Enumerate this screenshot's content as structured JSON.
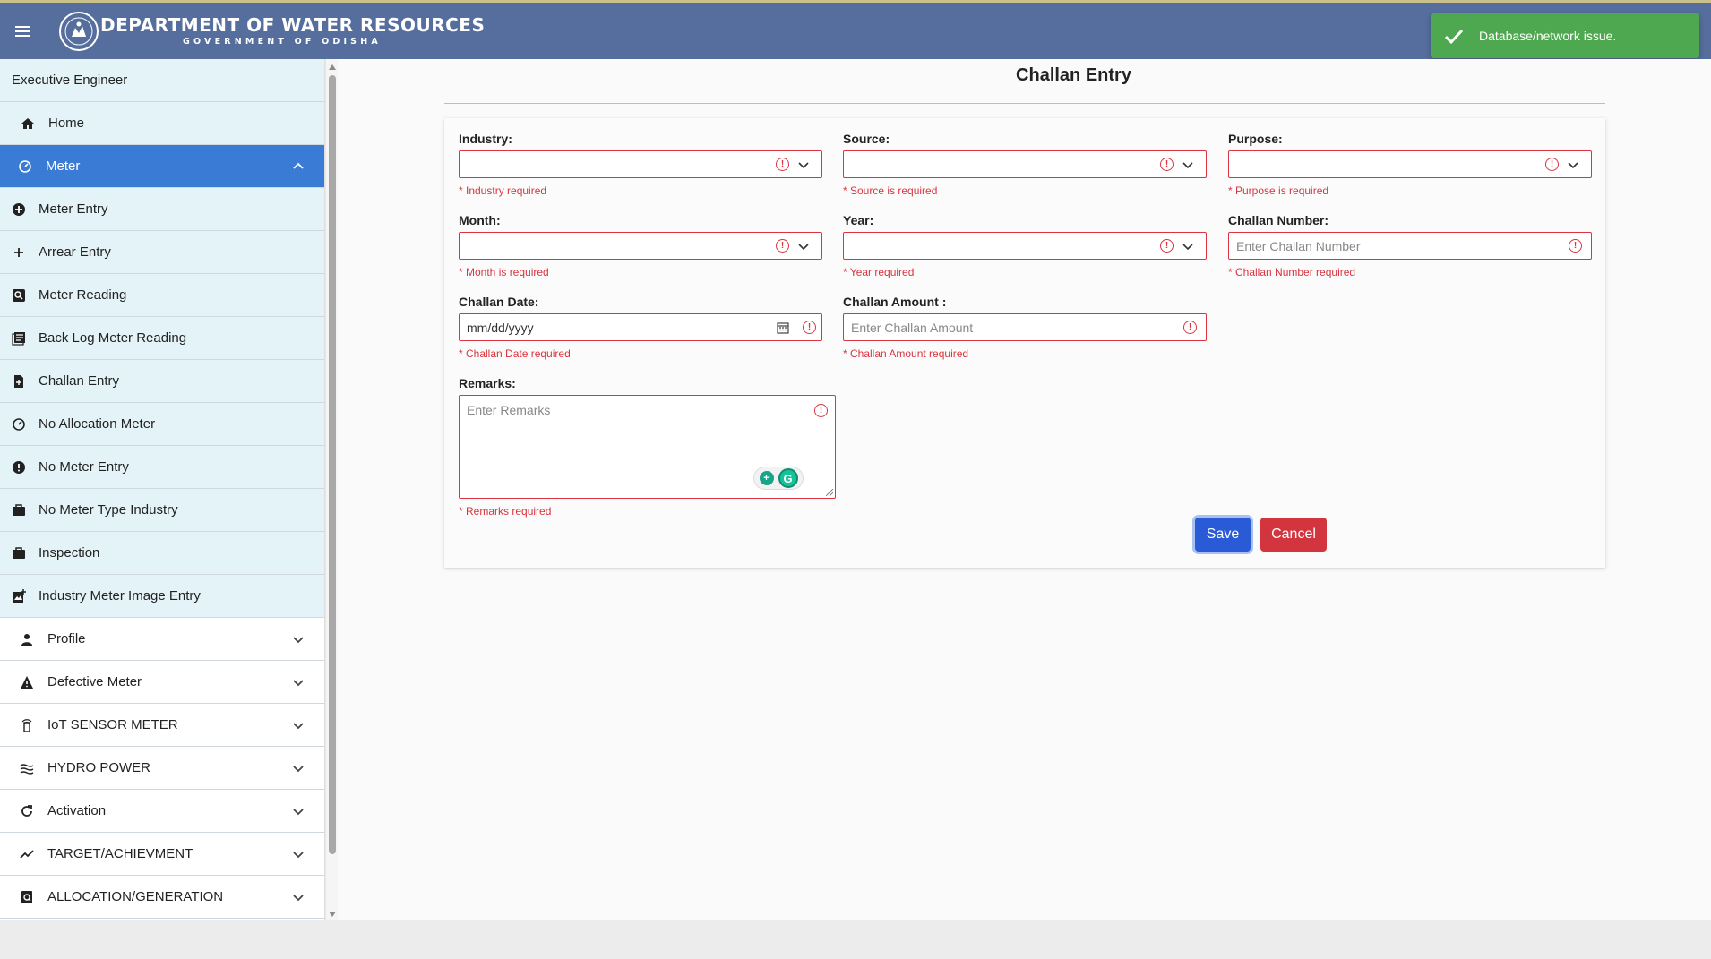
{
  "header": {
    "title": "DEPARTMENT OF WATER RESOURCES",
    "subtitle": "GOVERNMENT OF ODISHA"
  },
  "toast": {
    "message": "Database/network issue.",
    "color": "#4ea84f"
  },
  "sidebar": {
    "role": "Executive Engineer",
    "home": "Home",
    "active": "Meter",
    "sub_items": [
      {
        "label": "Meter Entry",
        "icon": "plus-circle-icon"
      },
      {
        "label": "Arrear Entry",
        "icon": "plus-icon"
      },
      {
        "label": "Meter Reading",
        "icon": "search-box-icon"
      },
      {
        "label": "Back Log Meter Reading",
        "icon": "list-icon"
      },
      {
        "label": "Challan Entry",
        "icon": "document-icon"
      },
      {
        "label": "No Allocation Meter",
        "icon": "gauge-icon"
      },
      {
        "label": "No Meter Entry",
        "icon": "alert-circle-icon"
      },
      {
        "label": "No Meter Type Industry",
        "icon": "briefcase-icon"
      },
      {
        "label": "Inspection",
        "icon": "briefcase-icon"
      },
      {
        "label": "Industry Meter Image Entry",
        "icon": "image-add-icon"
      }
    ],
    "groups": [
      {
        "label": "Profile",
        "icon": "person-icon"
      },
      {
        "label": "Defective Meter",
        "icon": "warning-icon"
      },
      {
        "label": "IoT SENSOR METER",
        "icon": "sensor-icon"
      },
      {
        "label": "HYDRO POWER",
        "icon": "water-icon"
      },
      {
        "label": "Activation",
        "icon": "refresh-icon"
      },
      {
        "label": "TARGET/ACHIEVMENT",
        "icon": "trend-icon"
      },
      {
        "label": "ALLOCATION/GENERATION",
        "icon": "doc-search-icon"
      }
    ]
  },
  "form": {
    "title": "Challan Entry",
    "industry": {
      "label": "Industry:",
      "error": "* Industry required"
    },
    "source": {
      "label": "Source:",
      "error": "* Source is required"
    },
    "purpose": {
      "label": "Purpose:",
      "error": "* Purpose is required"
    },
    "month": {
      "label": "Month:",
      "error": "* Month is required"
    },
    "year": {
      "label": "Year:",
      "error": "* Year required"
    },
    "challan_number": {
      "label": "Challan Number:",
      "placeholder": "Enter Challan Number",
      "error": "* Challan Number required"
    },
    "challan_date": {
      "label": "Challan Date:",
      "value": "mm/dd/yyyy",
      "error": "* Challan Date required"
    },
    "challan_amount": {
      "label": "Challan Amount :",
      "placeholder": "Enter Challan Amount",
      "error": "* Challan Amount required"
    },
    "remarks": {
      "label": "Remarks:",
      "placeholder": "Enter Remarks",
      "error": "* Remarks required"
    },
    "save_label": "Save",
    "cancel_label": "Cancel"
  },
  "colors": {
    "header_bg": "#556e9e",
    "active_item": "#3a7bd5",
    "error": "#d9343f",
    "save": "#2a5bd6",
    "cancel": "#d3353f"
  }
}
